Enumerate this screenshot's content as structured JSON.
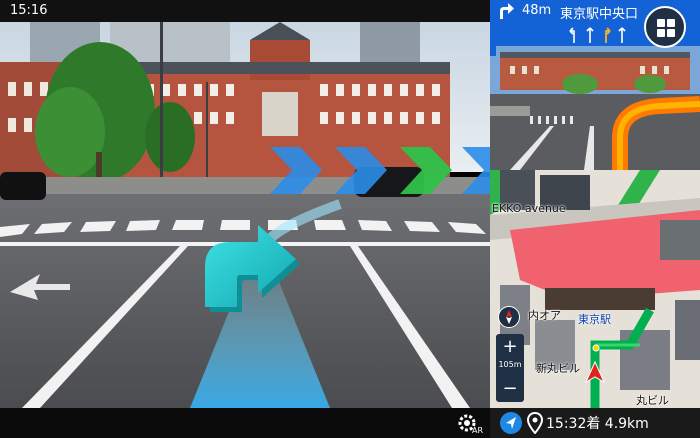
{
  "status": {
    "time": "15:16"
  },
  "guidance": {
    "distance": "48m",
    "place": "東京駅中央口"
  },
  "map": {
    "street_label": "EKKO avenue",
    "station_label": "東京駅",
    "building_label_1": "内オア",
    "building_label_2": "新丸ビル",
    "building_label_3": "丸ビル",
    "scale": "105m",
    "zoom_in": "+",
    "zoom_out": "−"
  },
  "bottom": {
    "eta": "15:32着 4.9km",
    "ar_label": "AR"
  },
  "icons": {
    "turn": "right-turn-arrow-icon",
    "menu": "grid-menu-icon",
    "compass": "compass-icon",
    "settings": "gear-ar-icon",
    "nav": "navigation-arrow-icon",
    "pin": "location-pin-icon"
  },
  "colors": {
    "accent": "#1463d6",
    "route": "#00b050",
    "ar_arrow": "#19c2c9"
  }
}
